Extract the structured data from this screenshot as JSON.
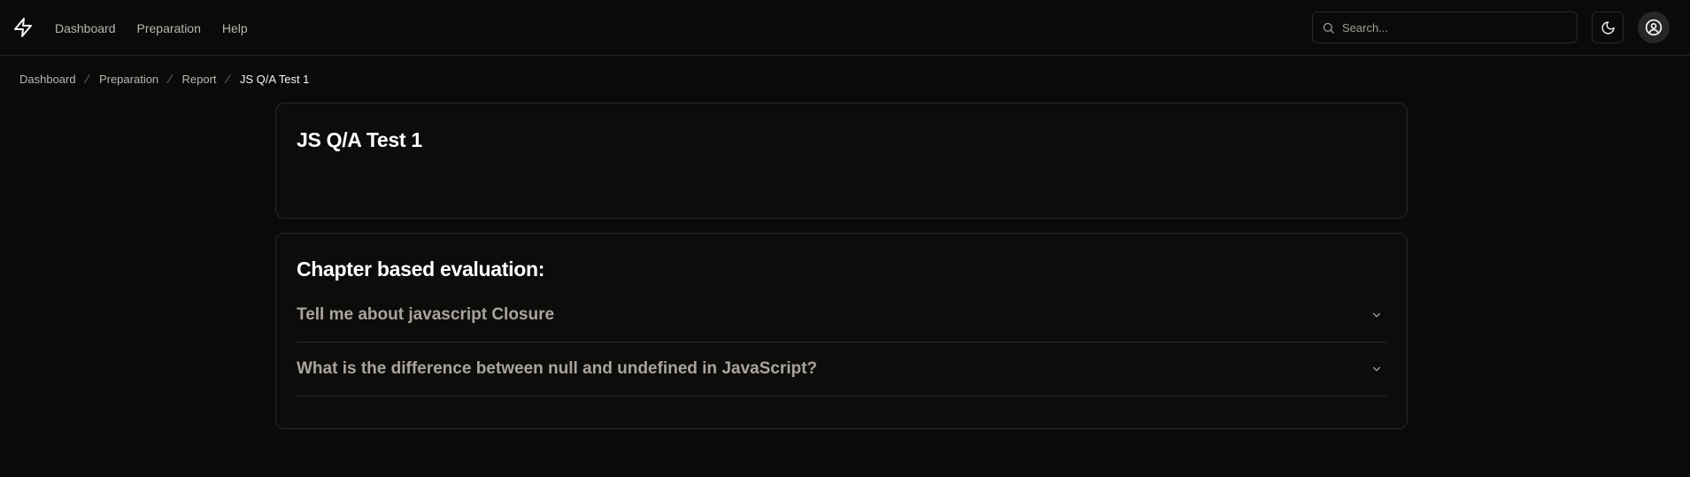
{
  "nav": {
    "logo_icon": "lightning-bolt-icon",
    "links": [
      "Dashboard",
      "Preparation",
      "Help"
    ]
  },
  "search": {
    "placeholder": "Search...",
    "icon": "search-icon"
  },
  "header_icons": {
    "theme_toggle": "moon-icon",
    "profile": "user-circle-icon"
  },
  "breadcrumb": [
    "Dashboard",
    "Preparation",
    "Report",
    "JS Q/A Test 1"
  ],
  "test": {
    "title": "JS Q/A Test 1"
  },
  "evaluation": {
    "heading": "Chapter based evaluation:",
    "questions": [
      "Tell me about javascript Closure",
      "What is the difference between null and undefined in JavaScript?"
    ],
    "expand_icon": "chevron-down-icon"
  },
  "colors": {
    "background": "#0b0a09",
    "border": "#2a2927",
    "muted_text": "#a8a49e"
  }
}
